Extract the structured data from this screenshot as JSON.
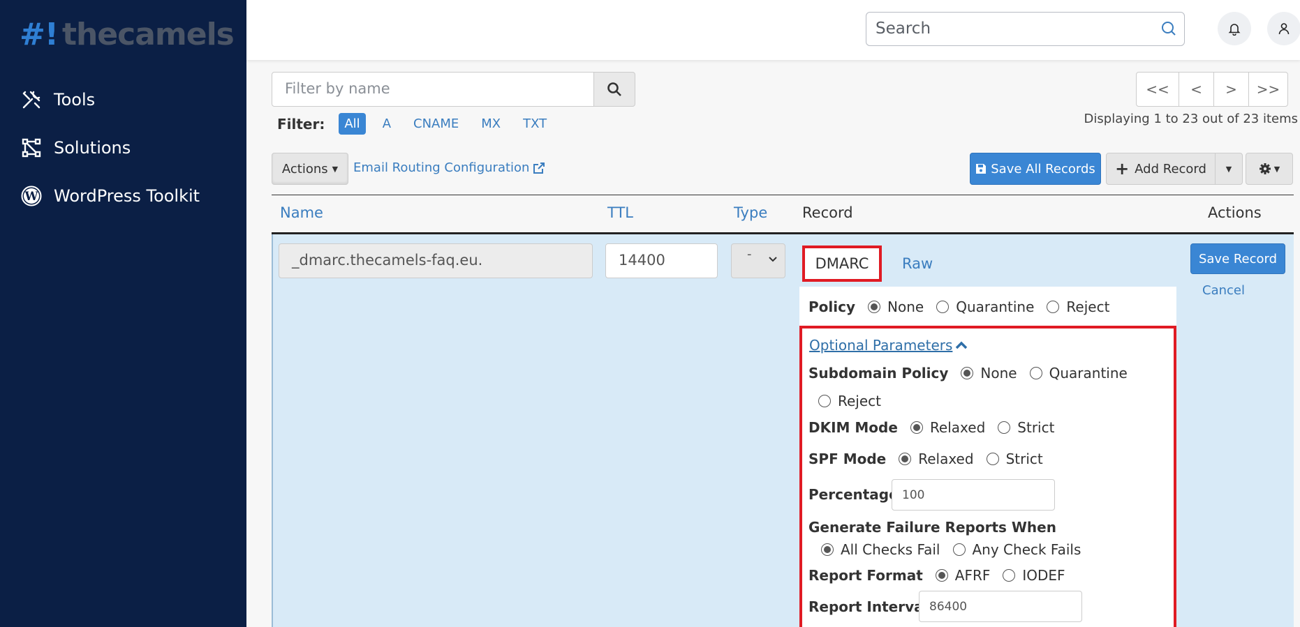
{
  "brand": {
    "hash": "#!",
    "name": "thecamels"
  },
  "sidebar": {
    "items": [
      {
        "label": "Tools",
        "icon": "tools-icon"
      },
      {
        "label": "Solutions",
        "icon": "solutions-icon"
      },
      {
        "label": "WordPress Toolkit",
        "icon": "wordpress-icon"
      }
    ]
  },
  "header": {
    "search_placeholder": "Search"
  },
  "filter": {
    "placeholder": "Filter by name",
    "label": "Filter:",
    "chips": [
      "All",
      "A",
      "CNAME",
      "MX",
      "TXT"
    ],
    "active": "All"
  },
  "pager": {
    "first": "<<",
    "prev": "<",
    "next": ">",
    "last": ">>",
    "info": "Displaying 1 to 23 out of 23 items"
  },
  "toolbar": {
    "actions_label": "Actions",
    "email_routing_label": "Email Routing Configuration",
    "save_all_label": "Save All Records",
    "add_record_label": "Add Record"
  },
  "table": {
    "headers": {
      "name": "Name",
      "ttl": "TTL",
      "type": "Type",
      "record": "Record",
      "actions": "Actions"
    }
  },
  "edit_row": {
    "name": "_dmarc.thecamels-faq.eu.",
    "ttl": "14400",
    "type": "-",
    "tabs": {
      "dmarc": "DMARC",
      "raw": "Raw"
    },
    "save_label": "Save Record",
    "cancel_label": "Cancel"
  },
  "dmarc": {
    "policy_label": "Policy",
    "policy_options": [
      "None",
      "Quarantine",
      "Reject"
    ],
    "optional_label": "Optional Parameters",
    "subdomain_label": "Subdomain Policy",
    "subdomain_options": [
      "None",
      "Quarantine",
      "Reject"
    ],
    "dkim_label": "DKIM Mode",
    "dkim_options": [
      "Relaxed",
      "Strict"
    ],
    "spf_label": "SPF Mode",
    "spf_options": [
      "Relaxed",
      "Strict"
    ],
    "percentage_label": "Percentage",
    "percentage_placeholder": "100",
    "failure_label": "Generate Failure Reports When",
    "failure_options": [
      "All Checks Fail",
      "Any Check Fails"
    ],
    "format_label": "Report Format",
    "format_options": [
      "AFRF",
      "IODEF"
    ],
    "interval_label": "Report Interval",
    "interval_placeholder": "86400"
  },
  "colors": {
    "sidebar": "#0b1f45",
    "accent": "#3a86d4",
    "highlight": "#e01b24",
    "row": "#d8eaf7"
  }
}
